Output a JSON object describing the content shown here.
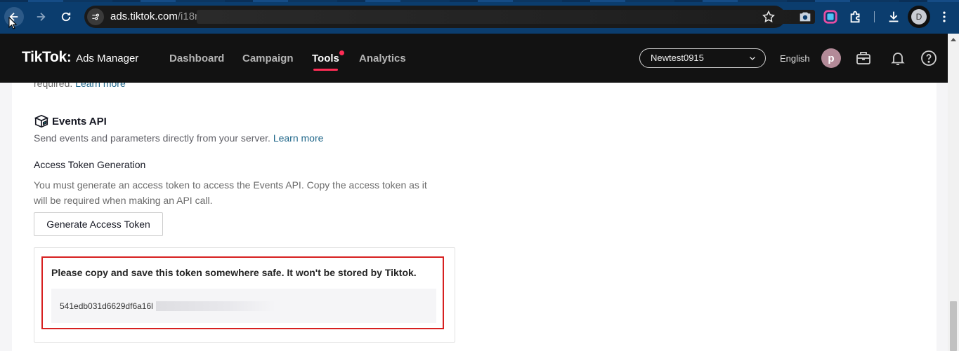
{
  "browser": {
    "url_host": "ads.tiktok.com",
    "url_path": "/i18n/",
    "profile_initial": "D"
  },
  "header": {
    "brand_name": "TikTok",
    "brand_product": "Ads Manager",
    "nav": [
      {
        "label": "Dashboard"
      },
      {
        "label": "Campaign"
      },
      {
        "label": "Tools"
      },
      {
        "label": "Analytics"
      }
    ],
    "account": "Newtest0915",
    "language": "English",
    "avatar_initial": "p"
  },
  "content": {
    "cut_text": "required.",
    "cut_link": "Learn more",
    "events_api_title": "Events API",
    "events_api_desc": "Send events and parameters directly from your server.",
    "events_api_link": "Learn more",
    "token_section_title": "Access Token Generation",
    "token_section_desc": "You must generate an access token to access the Events API. Copy the access token as it will be required when making an API call.",
    "generate_button": "Generate Access Token",
    "warning": "Please copy and save this token somewhere safe. It won't be stored by Tiktok.",
    "token_value": "541edb031d6629df6a16l"
  },
  "colors": {
    "accent": "#fe2c55",
    "link": "#20678a",
    "highlight_border": "#d72020"
  }
}
